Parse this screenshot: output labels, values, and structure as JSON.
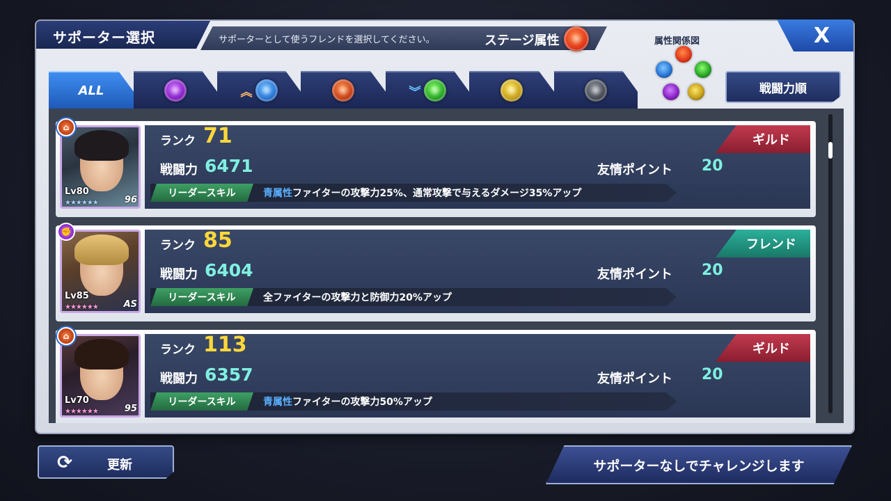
{
  "header": {
    "title": "サポーター選択",
    "instruction": "サポーターとして使うフレンドを選択してください。",
    "stage_attribute_label": "ステージ属性",
    "stage_attribute_icon": "red-attribute-orb-icon",
    "close_label": "X",
    "relation_chart_label": "属性関係図",
    "sort_label": "戦闘力順"
  },
  "tabs": [
    {
      "label": "ALL",
      "icon": null,
      "active": true
    },
    {
      "label": "",
      "icon": "purple-attribute-orb-icon",
      "arrow": null
    },
    {
      "label": "",
      "icon": "blue-attribute-orb-icon",
      "arrow": "up"
    },
    {
      "label": "",
      "icon": "orange-attribute-orb-icon",
      "arrow": null
    },
    {
      "label": "",
      "icon": "green-attribute-orb-icon",
      "arrow": "down"
    },
    {
      "label": "",
      "icon": "yellow-attribute-orb-icon",
      "arrow": null
    },
    {
      "label": "",
      "icon": "gray-attribute-orb-icon",
      "arrow": null
    }
  ],
  "supporters": [
    {
      "rank_label": "ランク",
      "rank": "71",
      "power_label": "戦闘力",
      "power": "6471",
      "fp_label": "友情ポイント",
      "fp": "20",
      "skill_tag": "リーダースキル",
      "skill_attr": "青属性",
      "skill_text": "ファイターの攻撃力25%、通常攻撃で与えるダメージ35%アップ",
      "relation": "ギルド",
      "level": "Lv80",
      "stars": "★★★★★★",
      "series": "96"
    },
    {
      "rank_label": "ランク",
      "rank": "85",
      "power_label": "戦闘力",
      "power": "6404",
      "fp_label": "友情ポイント",
      "fp": "20",
      "skill_tag": "リーダースキル",
      "skill_attr": "",
      "skill_text": "全ファイターの攻撃力と防御力20%アップ",
      "relation": "フレンド",
      "level": "Lv85",
      "stars": "★★★★★★",
      "series": "AS"
    },
    {
      "rank_label": "ランク",
      "rank": "113",
      "power_label": "戦闘力",
      "power": "6357",
      "fp_label": "友情ポイント",
      "fp": "20",
      "skill_tag": "リーダースキル",
      "skill_attr": "青属性",
      "skill_text": "ファイターの攻撃力50%アップ",
      "relation": "ギルド",
      "level": "Lv70",
      "stars": "★★★★★★",
      "series": "95"
    }
  ],
  "footer": {
    "refresh_label": "更新",
    "challenge_label": "サポーターなしでチャレンジします"
  },
  "colors": {
    "accent_blue": "#2a78d8",
    "rank_yellow": "#ffd83a",
    "value_cyan": "#7ff0e0",
    "guild_red": "#c23a4e",
    "friend_teal": "#2ab09a"
  }
}
